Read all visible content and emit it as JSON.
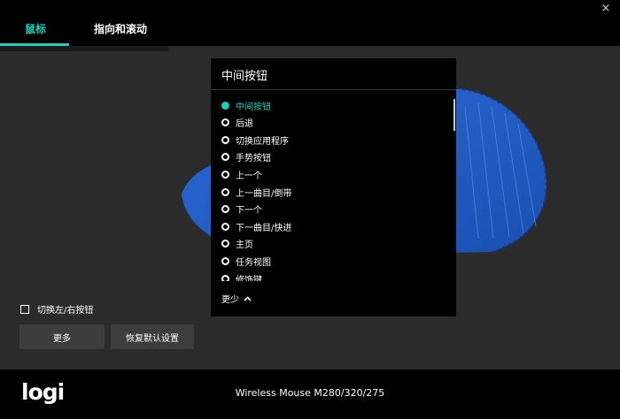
{
  "window": {
    "close_glyph": "×"
  },
  "tabs": [
    {
      "label": "鼠标",
      "active": true
    },
    {
      "label": "指向和滚动",
      "active": false
    }
  ],
  "dropdown": {
    "title": "中间按钮",
    "options": [
      {
        "label": "中间按钮",
        "selected": true
      },
      {
        "label": "后退",
        "selected": false
      },
      {
        "label": "切换应用程序",
        "selected": false
      },
      {
        "label": "手势按钮",
        "selected": false
      },
      {
        "label": "上一个",
        "selected": false
      },
      {
        "label": "上一曲目/倒带",
        "selected": false
      },
      {
        "label": "下一个",
        "selected": false
      },
      {
        "label": "下一曲目/快进",
        "selected": false
      },
      {
        "label": "主页",
        "selected": false
      },
      {
        "label": "任务视图",
        "selected": false
      },
      {
        "label": "修饰键",
        "selected": false
      }
    ],
    "less_label": "更少"
  },
  "controls": {
    "swap_buttons_label": "切换左/右按钮",
    "swap_checked": false,
    "more_label": "更多",
    "reset_label": "恢复默认设置"
  },
  "footer": {
    "logo": "logi",
    "device_name": "Wireless Mouse M280/320/275"
  },
  "colors": {
    "accent": "#15d2c0",
    "mouse_blue": "#1f5fc8",
    "background": "#2b2b2b",
    "panel": "#000000"
  }
}
